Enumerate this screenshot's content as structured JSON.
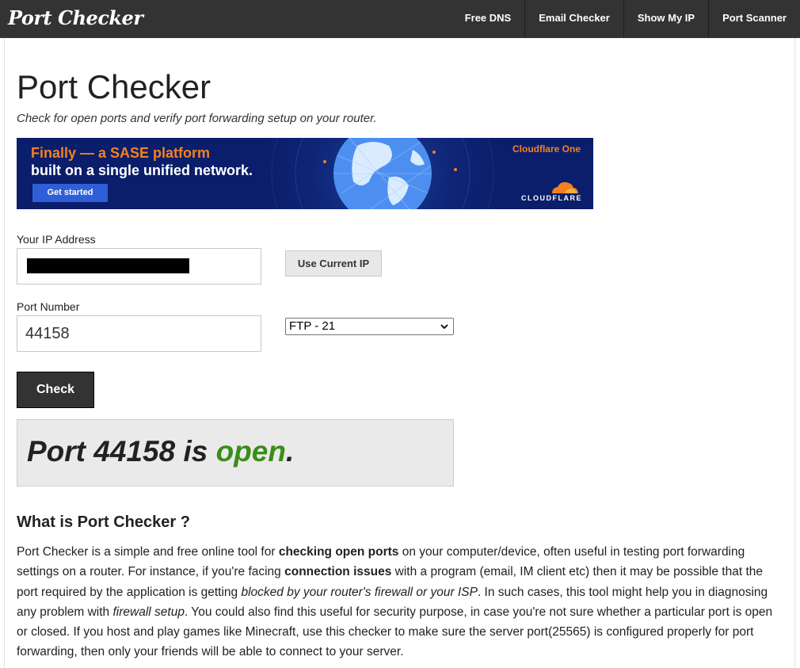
{
  "header": {
    "logo": "Port Checker",
    "nav": [
      "Free DNS",
      "Email Checker",
      "Show My IP",
      "Port Scanner"
    ]
  },
  "main": {
    "title": "Port Checker",
    "subtitle": "Check for open ports and verify port forwarding setup on your router."
  },
  "ad": {
    "headline_1": "Finally — a SASE platform",
    "headline_2": "built on a single unified network.",
    "cta": "Get started",
    "tag": "Cloudflare One",
    "brand": "CLOUDFLARE"
  },
  "form": {
    "ip_label": "Your IP Address",
    "ip_value": "",
    "use_current_ip": "Use Current IP",
    "port_label": "Port Number",
    "port_value": "44158",
    "service_selected": "FTP - 21",
    "check_button": "Check"
  },
  "result": {
    "prefix": "Port 44158 is ",
    "status": "open",
    "suffix": "."
  },
  "about": {
    "heading": "What is Port Checker ?",
    "p1": "Port Checker is a simple and free online tool for ",
    "b1": "checking open ports",
    "p2": " on your computer/device, often useful in testing port forwarding settings on a router. For instance, if you're facing ",
    "b2": "connection issues",
    "p3": " with a program (email, IM client etc) then it may be possible that the port required by the application is getting ",
    "i1": "blocked by your router's firewall or your ISP",
    "p4": ". In such cases, this tool might help you in diagnosing any problem with ",
    "i2": "firewall setup",
    "p5": ". You could also find this useful for security purpose, in case you're not sure whether a particular port is open or closed. If you host and play games like Minecraft, use this checker to make sure the server port(25565) is configured properly for port forwarding, then only your friends will be able to connect to your server."
  },
  "colors": {
    "nav_bg": "#333333",
    "open_status": "#3a8d1b",
    "ad_bg": "#0b1e6b",
    "ad_accent": "#f48120"
  }
}
